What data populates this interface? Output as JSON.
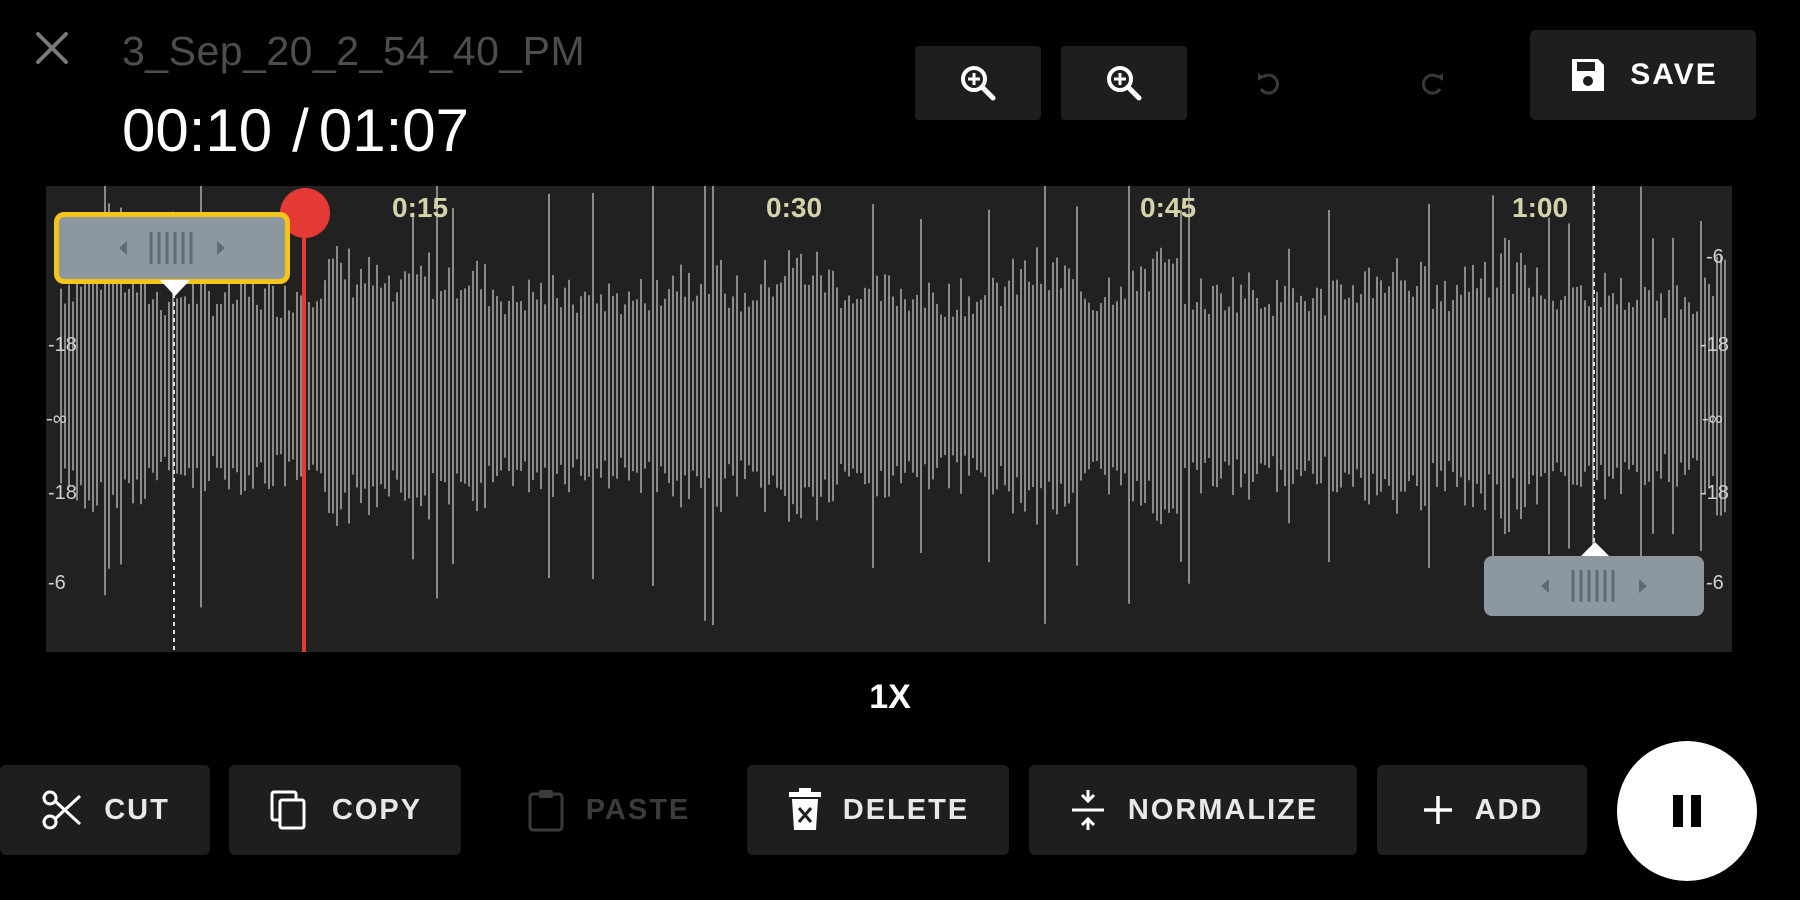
{
  "header": {
    "file_name": "3_Sep_20_2_54_40_PM",
    "current_time": "00:10",
    "separator": "/",
    "total_time": "01:07",
    "close_icon": "close-icon"
  },
  "toolbar": {
    "zoom_in_icon": "zoom-in-icon",
    "zoom_out_icon": "zoom-out-icon",
    "undo_icon": "undo-icon",
    "redo_icon": "redo-icon",
    "save_icon": "floppy-disk-icon",
    "save_label": "SAVE"
  },
  "waveform": {
    "ticks": [
      "0:15",
      "0:30",
      "0:45",
      "1:00"
    ],
    "db_labels": {
      "left": [
        "-18",
        "-∞",
        "-18",
        "-6"
      ],
      "right": [
        "-6",
        "-18",
        "-∞",
        "-18",
        "-6"
      ]
    },
    "playhead_position_sec": 10,
    "duration_sec": 67,
    "selection_start_sec": 3.5,
    "selection_end_sec": 63.5,
    "colors": {
      "background": "#212121",
      "wave": "#8a8a8a",
      "playhead": "#e53935",
      "tick_text": "#d6d2a9",
      "handle": "#8c97a0",
      "active_handle_border": "#f5c518"
    }
  },
  "playback": {
    "speed_label": "1X"
  },
  "actions": {
    "cut": "CUT",
    "copy": "COPY",
    "paste": "PASTE",
    "delete": "DELETE",
    "normalize": "NORMALIZE",
    "add": "ADD"
  },
  "fab": {
    "icon": "pause-icon"
  }
}
